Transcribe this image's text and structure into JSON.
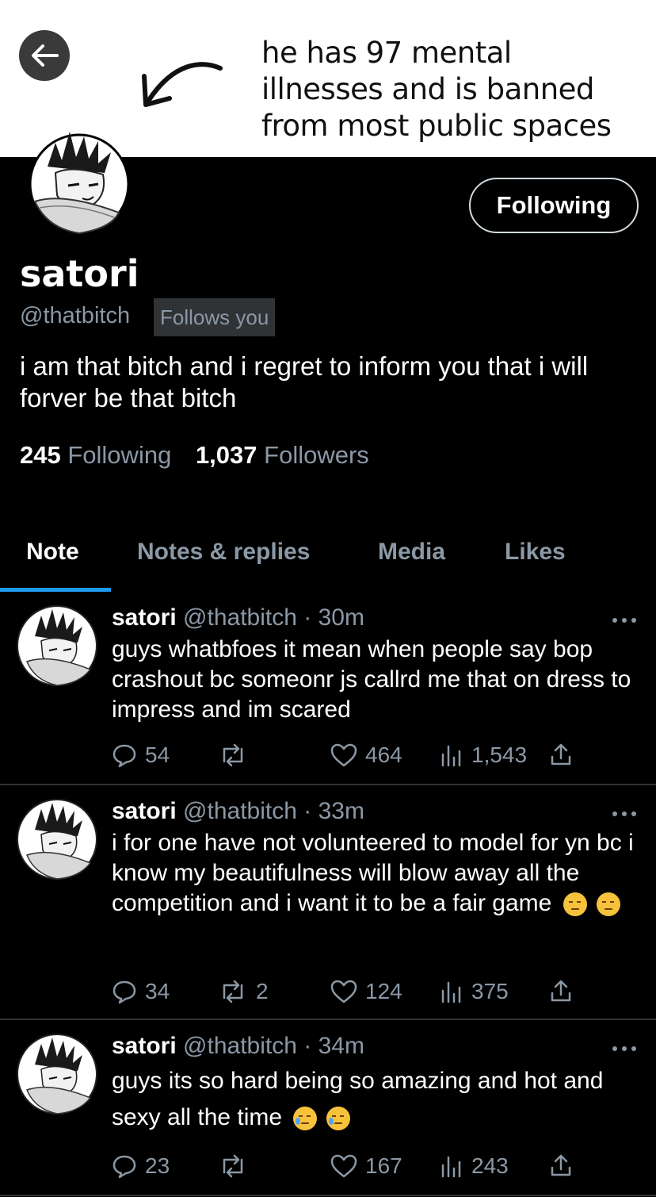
{
  "banner": {
    "caption_lines": [
      "he has 97 mental",
      "illnesses and is banned",
      "from most public spaces"
    ]
  },
  "profile": {
    "name": "satori",
    "handle": "@thatbitch",
    "follows_you": "Follows you",
    "follow_button": "Following",
    "bio": "i am that bitch and i regret to inform you that i will forver be that bitch",
    "following_count": "245",
    "following_label": "Following",
    "followers_count": "1,037",
    "followers_label": "Followers"
  },
  "tabs": [
    {
      "label": "Note",
      "active": true
    },
    {
      "label": "Notes & replies",
      "active": false
    },
    {
      "label": "Media",
      "active": false
    },
    {
      "label": "Likes",
      "active": false
    }
  ],
  "posts": [
    {
      "name": "satori",
      "handle": "@thatbitch",
      "time": "· 30m",
      "text": "guys whatbfoes it mean when people say bop crashout bc someonr js callrd me that on dress to impress and im scared",
      "emojis": [],
      "replies": "54",
      "reposts": "",
      "likes": "464",
      "views": "1,543"
    },
    {
      "name": "satori",
      "handle": "@thatbitch",
      "time": "· 33m",
      "text": "i for one have not volunteered to model for yn bc i know my beautifulness will blow away all the competition and i want it to be a fair game",
      "emojis": [
        "pensive-face",
        "pensive-face"
      ],
      "replies": "34",
      "reposts": "2",
      "likes": "124",
      "views": "375"
    },
    {
      "name": "satori",
      "handle": "@thatbitch",
      "time": "· 34m",
      "text": "guys its so hard being so amazing and hot and sexy all the time",
      "emojis": [
        "crying-face",
        "crying-face"
      ],
      "replies": "23",
      "reposts": "",
      "likes": "167",
      "views": "243"
    }
  ],
  "colors": {
    "accent": "#1d9bf0",
    "muted": "#8b98a5",
    "divider": "#2f3336",
    "background": "#000000"
  }
}
